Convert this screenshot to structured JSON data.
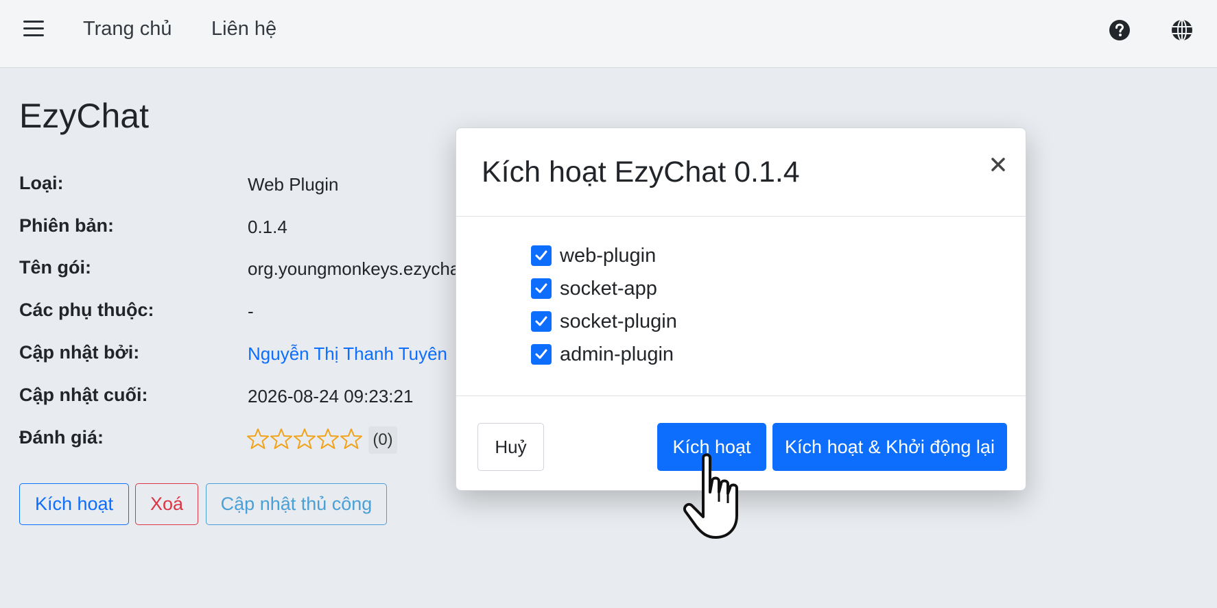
{
  "navbar": {
    "menu_icon": "hamburger-menu-icon",
    "links": [
      "Trang chủ",
      "Liên hệ"
    ],
    "right_icons": [
      "help-icon",
      "globe-icon"
    ]
  },
  "page": {
    "title": "EzyChat",
    "info": [
      {
        "label": "Loại:",
        "value": "Web Plugin"
      },
      {
        "label": "Phiên bản:",
        "value": "0.1.4"
      },
      {
        "label": "Tên gói:",
        "value": "org.youngmonkeys.ezychat"
      },
      {
        "label": "Các phụ thuộc:",
        "value": "-"
      },
      {
        "label": "Cập nhật bởi:",
        "value": "Nguyễn Thị Thanh Tuyên"
      },
      {
        "label": "Cập nhật cuối:",
        "value": "2026-08-24 09:23:21"
      },
      {
        "label": "Đánh giá:",
        "value": ""
      }
    ],
    "rating": {
      "stars_filled": 0,
      "stars_total": 5,
      "count": "(0)",
      "star_color": "#f0a31a"
    },
    "actions": {
      "activate": "Kích hoạt",
      "delete": "Xoá",
      "manual_update": "Cập nhật thủ công"
    }
  },
  "modal": {
    "title": "Kích hoạt EzyChat 0.1.4",
    "options": [
      {
        "label": "web-plugin",
        "checked": true
      },
      {
        "label": "socket-app",
        "checked": true
      },
      {
        "label": "socket-plugin",
        "checked": true
      },
      {
        "label": "admin-plugin",
        "checked": true
      }
    ],
    "buttons": {
      "cancel": "Huỷ",
      "activate": "Kích hoạt",
      "activate_restart": "Kích hoạt & Khởi động lại"
    }
  },
  "colors": {
    "primary": "#0d6efd",
    "danger": "#dc3545",
    "info": "#4aa0d6",
    "background": "#e8ebef"
  }
}
